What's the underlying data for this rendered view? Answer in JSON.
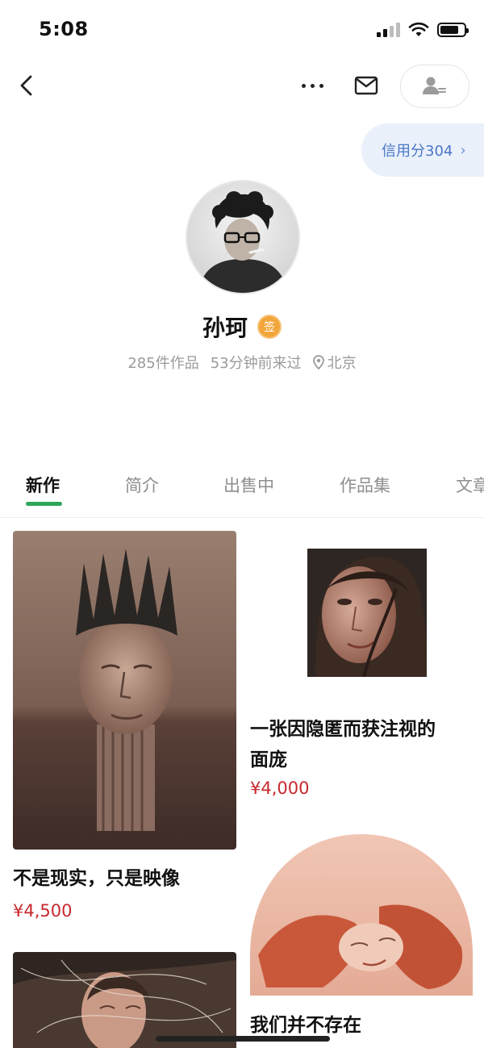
{
  "status_bar": {
    "time": "5:08"
  },
  "nav": {
    "back_icon": "chevron-left-icon",
    "more_icon": "more-dots-icon",
    "mail_icon": "mail-icon",
    "follow_icon": "user-follow-icon"
  },
  "credit": {
    "label": "信用分304",
    "chevron": "›"
  },
  "profile": {
    "name": "孙珂",
    "badge": "签",
    "works_count": "285件作品",
    "last_seen": "53分钟前来过",
    "location": "北京"
  },
  "tabs": [
    {
      "label": "新作",
      "active": true
    },
    {
      "label": "简介",
      "active": false
    },
    {
      "label": "出售中",
      "active": false
    },
    {
      "label": "作品集",
      "active": false
    },
    {
      "label": "文章",
      "active": false
    }
  ],
  "works": [
    {
      "title": "不是现实，只是映像",
      "price": "¥4,500"
    },
    {
      "title_line1": "一张因隐匿而获注视的",
      "title_line2": "面庞",
      "price": "¥4,000"
    },
    {
      "title": "我们并不存在"
    }
  ],
  "colors": {
    "accent_green": "#2ea65a",
    "price_red": "#c8282d",
    "credit_blue": "#4a76c6"
  }
}
